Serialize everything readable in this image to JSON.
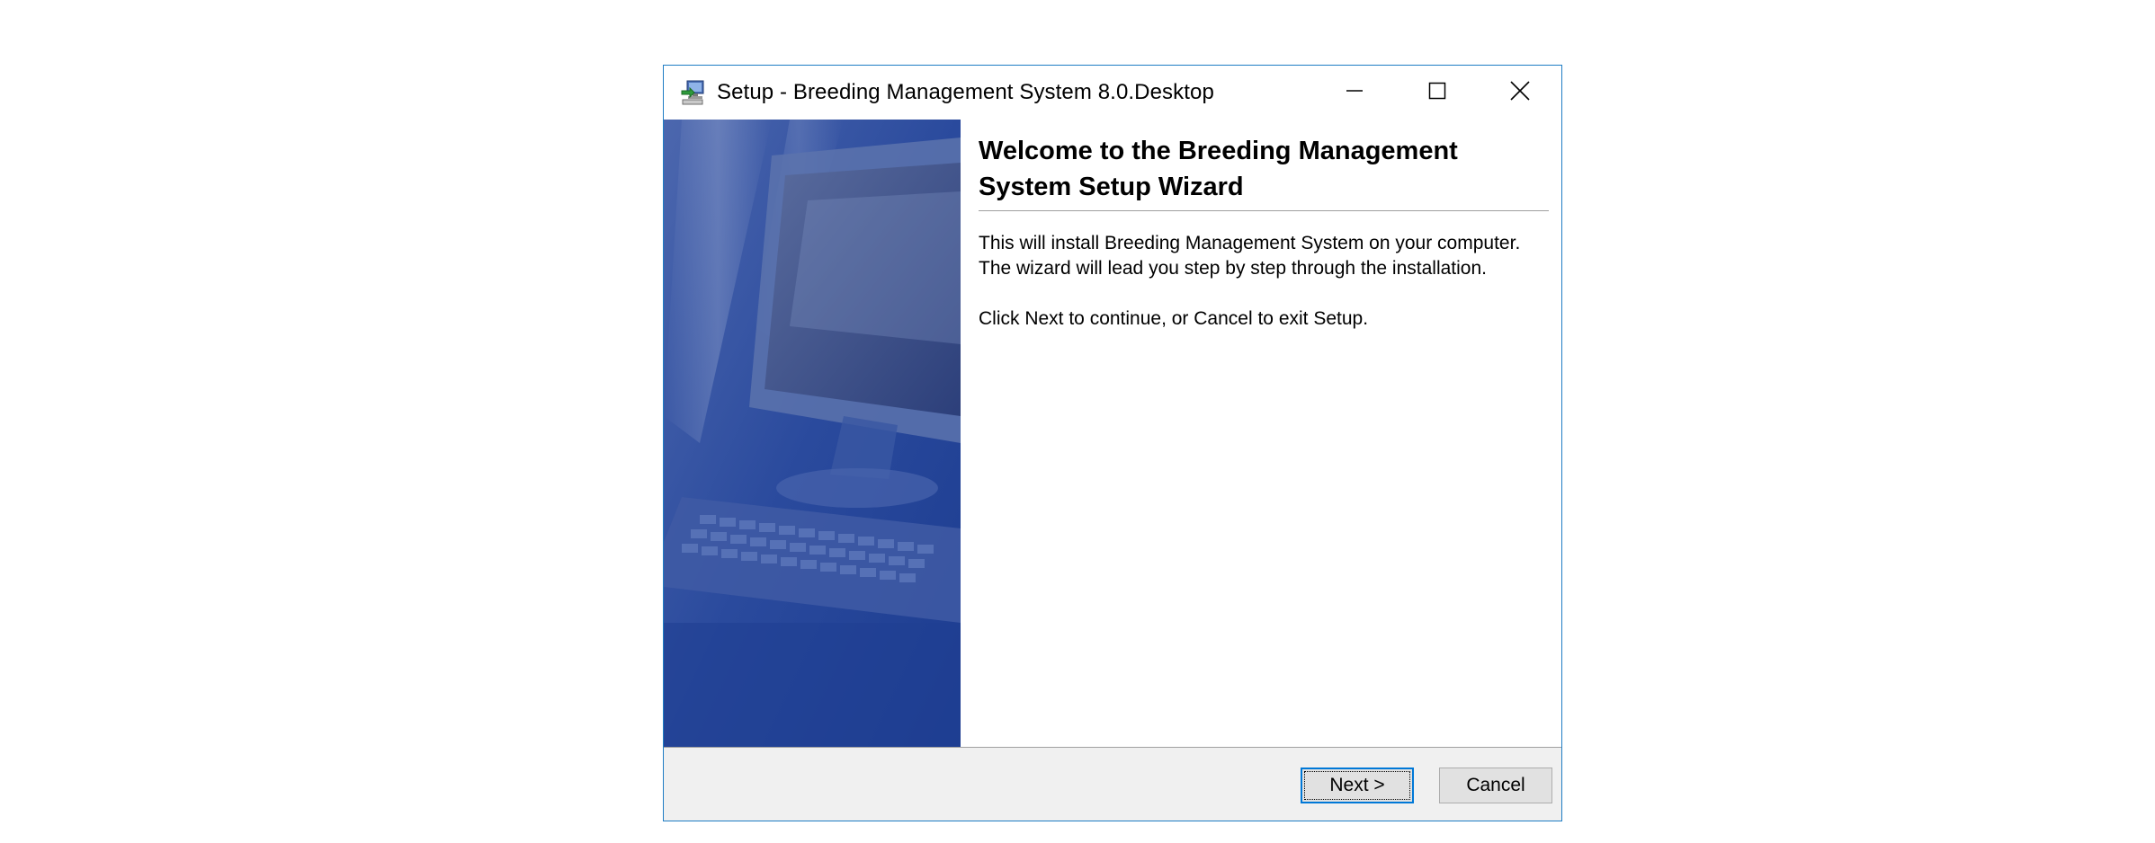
{
  "window": {
    "title": "Setup - Breeding Management System 8.0.Desktop",
    "icons": {
      "app": "setup-computer-icon",
      "minimize": "minimize-icon",
      "maximize": "maximize-icon",
      "close": "close-icon"
    }
  },
  "banner": {
    "image": "computer-monitor-keyboard-illustration",
    "colors": {
      "primary": "#2d4b9e",
      "accent": "#6c82c0"
    }
  },
  "main": {
    "heading": "Welcome to the Breeding Management System Setup Wizard",
    "paragraph1_line1": "This will install Breeding Management System on your computer.",
    "paragraph1_line2": "The wizard will lead you step by step through the installation.",
    "paragraph2": "Click Next to continue, or Cancel to exit Setup."
  },
  "footer": {
    "next_label": "Next >",
    "cancel_label": "Cancel"
  },
  "colors": {
    "window_border": "#1f7dc4",
    "footer_bg": "#f0f0f0",
    "default_button_border": "#0078d7"
  }
}
